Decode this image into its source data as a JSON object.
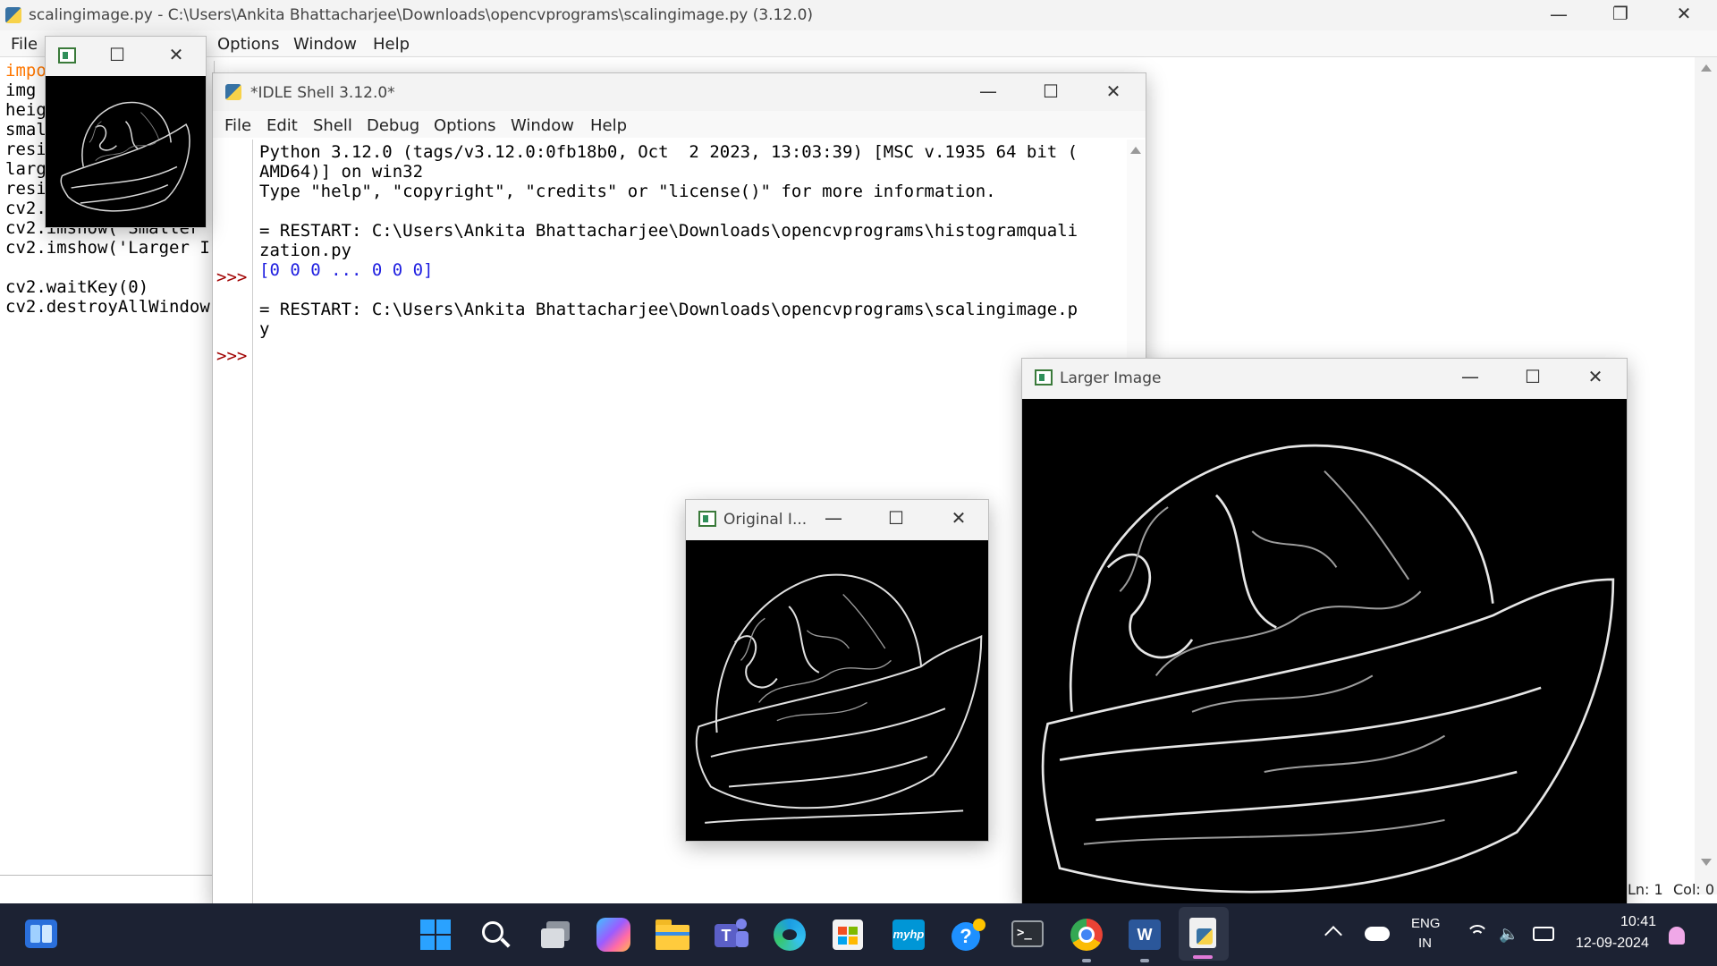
{
  "editor": {
    "title": "scalingimage.py - C:\\Users\\Ankita Bhattacharjee\\Downloads\\opencvprograms\\scalingimage.py (3.12.0)",
    "menu": [
      "File",
      "Options",
      "Window",
      "Help"
    ],
    "code_lines": [
      {
        "text": "impo",
        "color": "#ff7700"
      },
      {
        "text": "img ",
        "color": "#000000"
      },
      {
        "text": "heig",
        "color": "#000000"
      },
      {
        "text": "smal",
        "color": "#000000"
      },
      {
        "text": "resi",
        "color": "#000000"
      },
      {
        "text": "larg",
        "color": "#000000"
      },
      {
        "text": "resi",
        "color": "#000000"
      },
      {
        "text": "cv2.",
        "color": "#000000"
      },
      {
        "text": "cv2.imshow('Smaller",
        "color": "#000000"
      },
      {
        "text": "cv2.imshow('Larger I",
        "color": "#000000"
      },
      {
        "text": "",
        "color": "#000000"
      },
      {
        "text": "cv2.waitKey(0)",
        "color": "#000000"
      },
      {
        "text": "cv2.destroyAllWindow",
        "color": "#000000"
      }
    ],
    "status": {
      "ln": "Ln: 1",
      "col": "Col: 0"
    }
  },
  "shell": {
    "title": "*IDLE Shell 3.12.0*",
    "menu": [
      "File",
      "Edit",
      "Shell",
      "Debug",
      "Options",
      "Window",
      "Help"
    ],
    "prompts": [
      ">>>",
      ">>>"
    ],
    "lines": [
      {
        "text": "Python 3.12.0 (tags/v3.12.0:0fb18b0, Oct  2 2023, 13:03:39) [MSC v.1935 64 bit (",
        "color": "#000000"
      },
      {
        "text": "AMD64)] on win32",
        "color": "#000000"
      },
      {
        "text": "Type \"help\", \"copyright\", \"credits\" or \"license()\" for more information.",
        "color": "#000000"
      },
      {
        "text": "",
        "color": "#000000"
      },
      {
        "text": "= RESTART: C:\\Users\\Ankita Bhattacharjee\\Downloads\\opencvprograms\\histogramquali",
        "color": "#000000"
      },
      {
        "text": "zation.py",
        "color": "#000000"
      },
      {
        "text": "[0 0 0 ... 0 0 0]",
        "color": "#2020e0"
      },
      {
        "text": "",
        "color": "#000000"
      },
      {
        "text": "= RESTART: C:\\Users\\Ankita Bhattacharjee\\Downloads\\opencvprograms\\scalingimage.p",
        "color": "#000000"
      },
      {
        "text": "y",
        "color": "#000000"
      }
    ]
  },
  "original_window": {
    "title": "Original I..."
  },
  "larger_window": {
    "title": "Larger Image"
  },
  "smaller_window": {
    "title": ""
  },
  "taskbar": {
    "apps": [
      "start-icon",
      "search-icon",
      "task-view-icon",
      "copilot-icon",
      "file-explorer-icon",
      "teams-icon",
      "edge-icon",
      "store-icon",
      "myhp-icon",
      "help-icon",
      "terminal-icon",
      "chrome-icon",
      "word-icon",
      "python-idle-icon"
    ],
    "myhp_label": "myhp",
    "tray": {
      "lang_top": "ENG",
      "lang_bottom": "IN",
      "time": "10:41",
      "date": "12-09-2024"
    }
  }
}
